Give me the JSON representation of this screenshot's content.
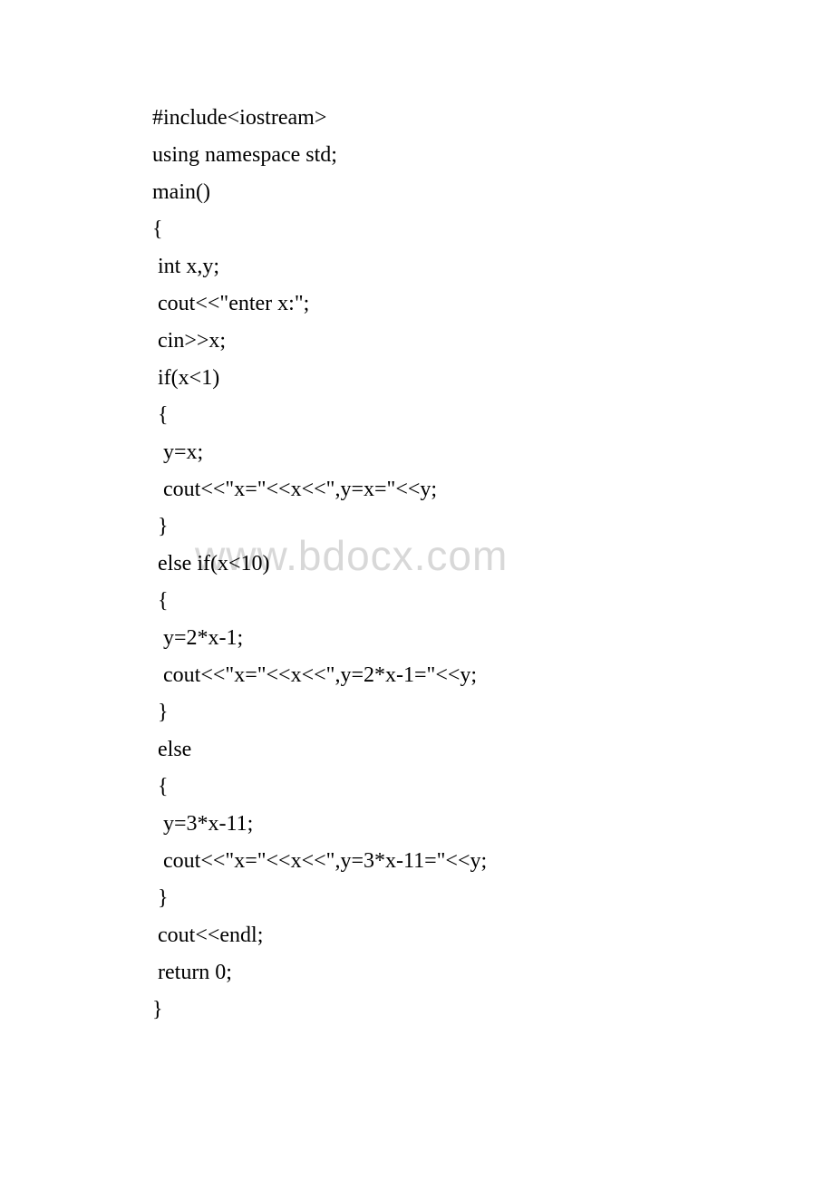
{
  "watermark": "www.bdocx.com",
  "code": {
    "lines": [
      "#include<iostream>",
      "using namespace std;",
      "main()",
      "{",
      " int x,y;",
      " cout<<\"enter x:\";",
      " cin>>x;",
      " if(x<1)",
      " {",
      "  y=x;",
      "  cout<<\"x=\"<<x<<\",y=x=\"<<y;",
      " }",
      " else if(x<10)",
      " {",
      "  y=2*x-1;",
      "  cout<<\"x=\"<<x<<\",y=2*x-1=\"<<y;",
      "",
      " }",
      " else",
      " {",
      "  y=3*x-11;",
      "  cout<<\"x=\"<<x<<\",y=3*x-11=\"<<y;",
      " }",
      " cout<<endl;",
      " return 0;",
      "}"
    ]
  }
}
